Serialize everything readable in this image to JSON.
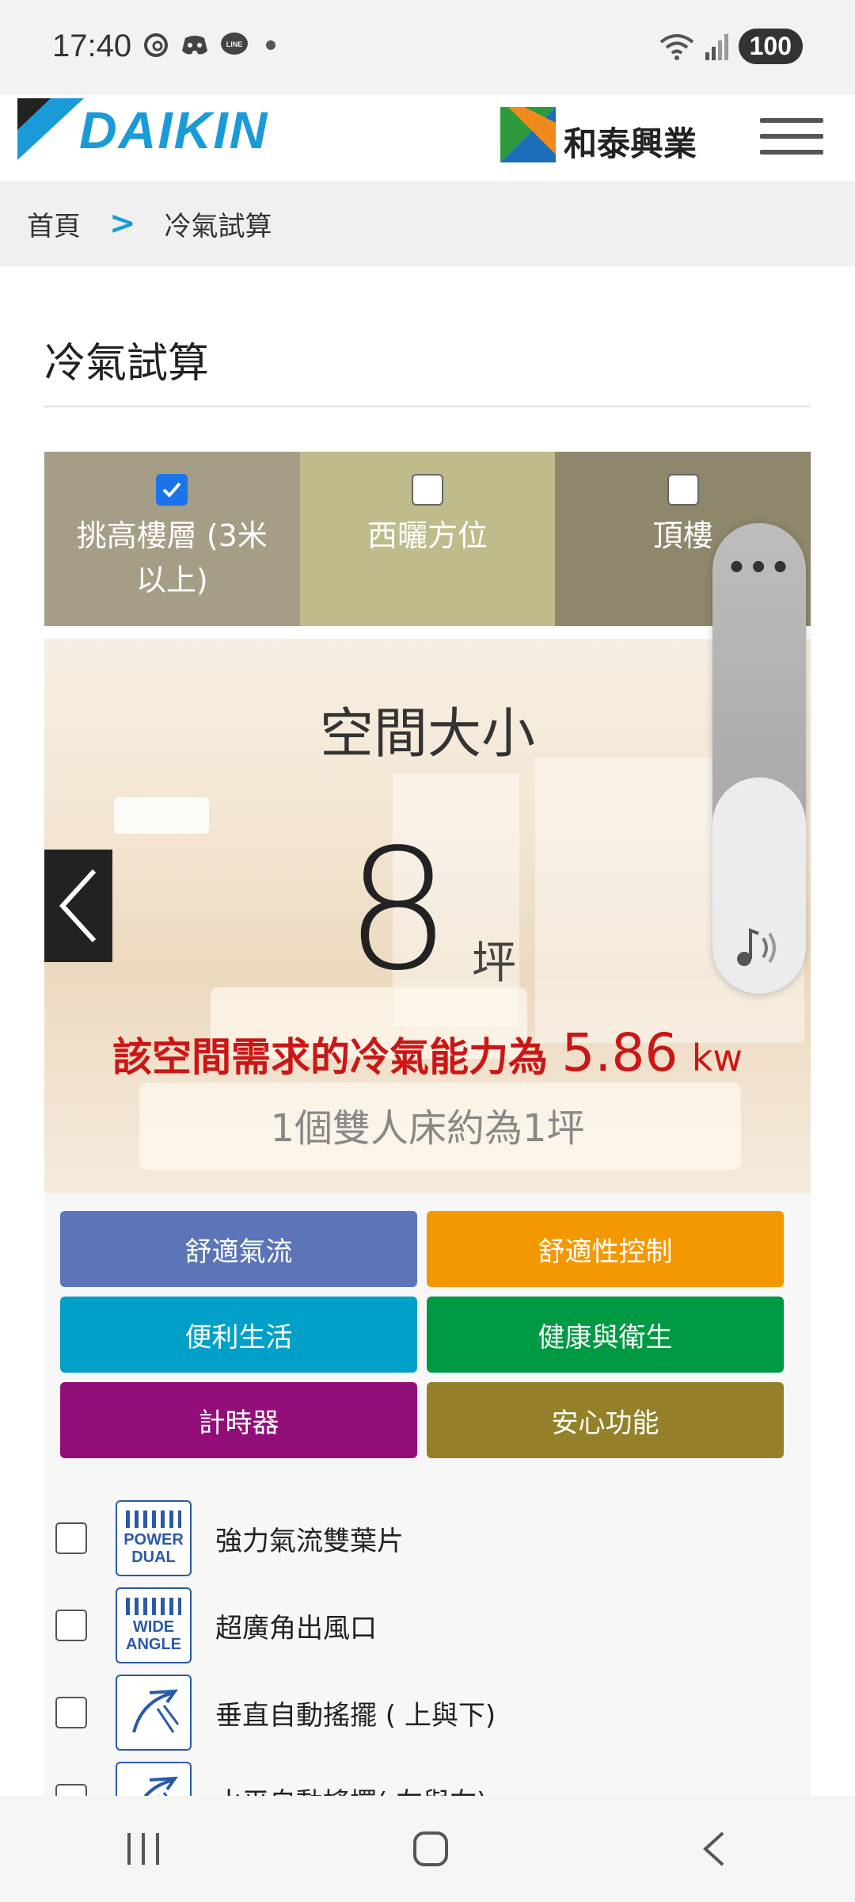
{
  "status_bar": {
    "time": "17:40",
    "battery": "100",
    "icons": [
      "threads-icon",
      "discord-icon",
      "line-icon",
      "wifi-icon",
      "signal-icon"
    ]
  },
  "header": {
    "brand": "DAIKIN",
    "partner": "和泰興業"
  },
  "breadcrumb": {
    "home": "首頁",
    "current": "冷氣試算"
  },
  "page": {
    "title": "冷氣試算"
  },
  "options": [
    {
      "label": "挑高樓層 (3米以上)",
      "checked": true
    },
    {
      "label": "西曬方位",
      "checked": false
    },
    {
      "label": "頂樓",
      "checked": false
    }
  ],
  "calculator": {
    "space_title": "空間大小",
    "size_value": "8",
    "size_unit": "坪",
    "capacity_prefix": "該空間需求的冷氣能力為",
    "capacity_value": "5.86",
    "capacity_unit": "kw",
    "note": "1個雙人床約為1坪"
  },
  "volume": {
    "menu": "•••",
    "level": 0.46
  },
  "categories": [
    {
      "label": "舒適氣流",
      "color": "#5b75b8"
    },
    {
      "label": "舒適性控制",
      "color": "#f39800"
    },
    {
      "label": "便利生活",
      "color": "#00a0c8"
    },
    {
      "label": "健康與衛生",
      "color": "#009944"
    },
    {
      "label": "計時器",
      "color": "#920f7a"
    },
    {
      "label": "安心功能",
      "color": "#938029"
    }
  ],
  "features": [
    {
      "label": "強力氣流雙葉片",
      "icon": "power-dual-icon",
      "icon_text": [
        "POWER",
        "DUAL"
      ]
    },
    {
      "label": "超廣角出風口",
      "icon": "wide-angle-icon",
      "icon_text": [
        "WIDE",
        "ANGLE"
      ]
    },
    {
      "label": "垂直自動搖擺 ( 上與下)",
      "icon": "vertical-swing-icon",
      "icon_text": []
    },
    {
      "label": "水平自動搖擺( 左與右)",
      "icon": "horizontal-swing-icon",
      "icon_text": []
    }
  ]
}
